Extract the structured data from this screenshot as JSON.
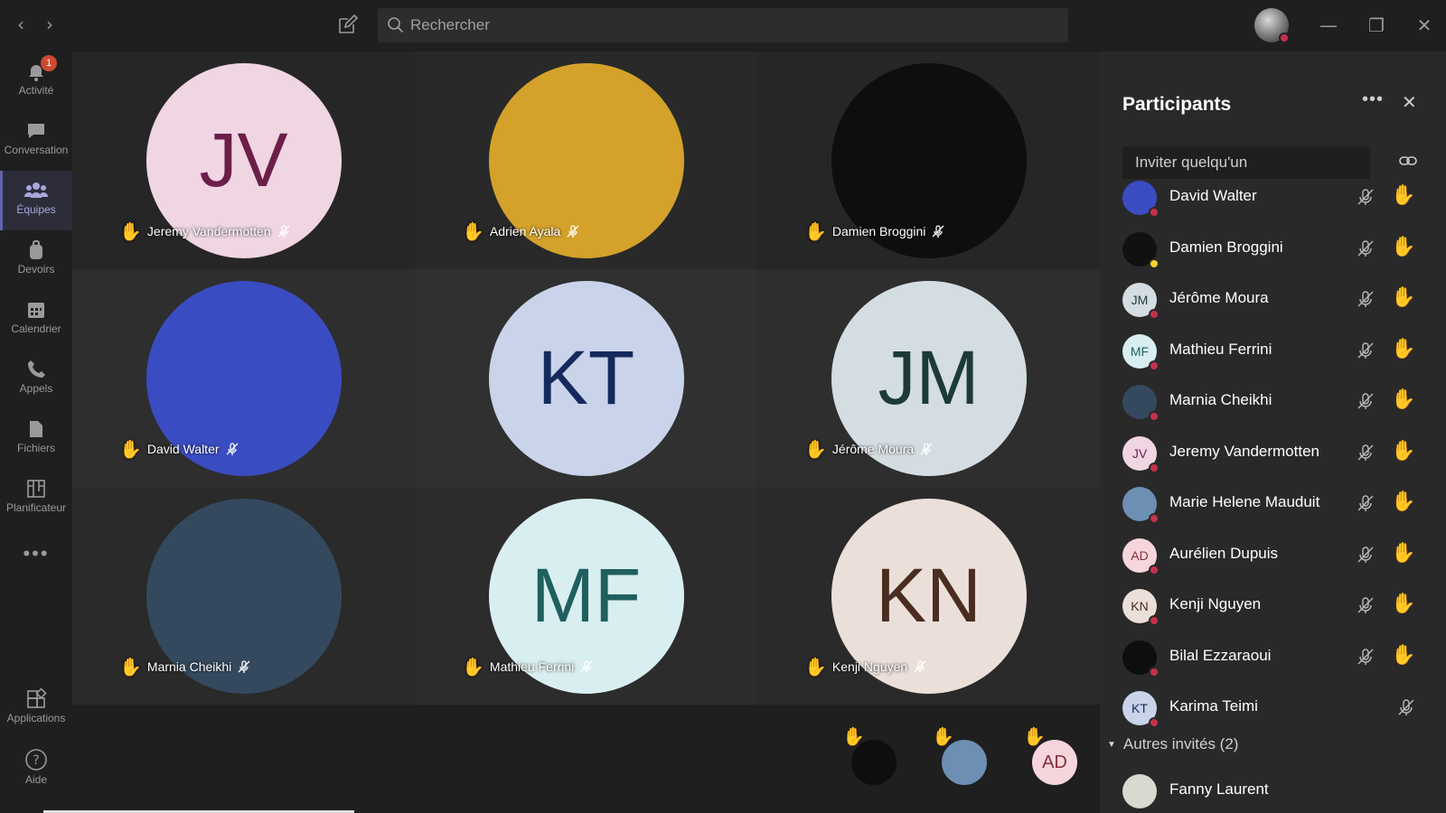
{
  "search": {
    "placeholder": "Rechercher"
  },
  "rail": {
    "items": [
      {
        "label": "Activité",
        "badge": "1"
      },
      {
        "label": "Conversation"
      },
      {
        "label": "Équipes"
      },
      {
        "label": "Devoirs"
      },
      {
        "label": "Calendrier"
      },
      {
        "label": "Appels"
      },
      {
        "label": "Fichiers"
      },
      {
        "label": "Planificateur"
      }
    ],
    "bottom": [
      {
        "label": "Applications"
      },
      {
        "label": "Aide"
      }
    ]
  },
  "tiles": [
    {
      "initials": "JV",
      "name": "Jeremy Vandermotten",
      "bg": "#f0d5e2",
      "fg": "#6b1e4a"
    },
    {
      "initials": "",
      "name": "Adrien Ayala",
      "bg": "#d4a22a",
      "fg": "#000"
    },
    {
      "initials": "",
      "name": "Damien Broggini",
      "bg": "#0e0e0e",
      "fg": "#fff"
    },
    {
      "initials": "",
      "name": "David Walter",
      "bg": "#3a4cc2",
      "fg": "#fff"
    },
    {
      "initials": "KT",
      "name": "",
      "bg": "#c9d3ea",
      "fg": "#152a5c"
    },
    {
      "initials": "JM",
      "name": "Jérôme Moura",
      "bg": "#d4dde2",
      "fg": "#1d3a3a"
    },
    {
      "initials": "",
      "name": "Marnia Cheikhi",
      "bg": "#34495e",
      "fg": "#fff"
    },
    {
      "initials": "MF",
      "name": "Mathieu Ferrini",
      "bg": "#d9eef0",
      "fg": "#1f5f5f"
    },
    {
      "initials": "KN",
      "name": "Kenji Nguyen",
      "bg": "#ebdfda",
      "fg": "#4a2c20"
    }
  ],
  "overflow": [
    {
      "initials": "",
      "bg": "#0e0e0e"
    },
    {
      "initials": "",
      "bg": "#6c8fb3"
    },
    {
      "initials": "AD",
      "bg": "#f6d6dc",
      "fg": "#8b2c3c"
    }
  ],
  "panel": {
    "title": "Participants",
    "invite_placeholder": "Inviter quelqu'un",
    "participants": [
      {
        "name": "David Walter",
        "initials": "",
        "bg": "#3a4cc2",
        "status": "busy",
        "hand": true
      },
      {
        "name": "Damien Broggini",
        "initials": "",
        "bg": "#111",
        "status": "away",
        "hand": true
      },
      {
        "name": "Jérôme Moura",
        "initials": "JM",
        "bg": "#d4dde2",
        "fg": "#1d3a3a",
        "status": "busy",
        "hand": true
      },
      {
        "name": "Mathieu Ferrini",
        "initials": "MF",
        "bg": "#d9eef0",
        "fg": "#1f5f5f",
        "status": "busy",
        "hand": true
      },
      {
        "name": "Marnia Cheikhi",
        "initials": "",
        "bg": "#34495e",
        "status": "busy",
        "hand": true
      },
      {
        "name": "Jeremy Vandermotten",
        "initials": "JV",
        "bg": "#f0d5e2",
        "fg": "#6b1e4a",
        "status": "busy",
        "hand": true
      },
      {
        "name": "Marie Helene Mauduit",
        "initials": "",
        "bg": "#6c8fb3",
        "status": "busy",
        "hand": true
      },
      {
        "name": "Aurélien Dupuis",
        "initials": "AD",
        "bg": "#f6d6dc",
        "fg": "#8b2c3c",
        "status": "busy",
        "hand": true
      },
      {
        "name": "Kenji Nguyen",
        "initials": "KN",
        "bg": "#ebdfda",
        "fg": "#4a2c20",
        "status": "busy",
        "hand": true
      },
      {
        "name": "Bilal Ezzaraoui",
        "initials": "",
        "bg": "#0e0e0e",
        "status": "busy",
        "hand": true
      },
      {
        "name": "Karima Teimi",
        "initials": "KT",
        "bg": "#c9d3ea",
        "fg": "#152a5c",
        "status": "busy",
        "hand": false
      }
    ],
    "others_header": "Autres invités (2)",
    "others": [
      {
        "name": "Fanny Laurent"
      }
    ]
  },
  "colors": {
    "accent": "#6264a7",
    "hand": "#f2b82f",
    "busy": "#c4314b"
  }
}
